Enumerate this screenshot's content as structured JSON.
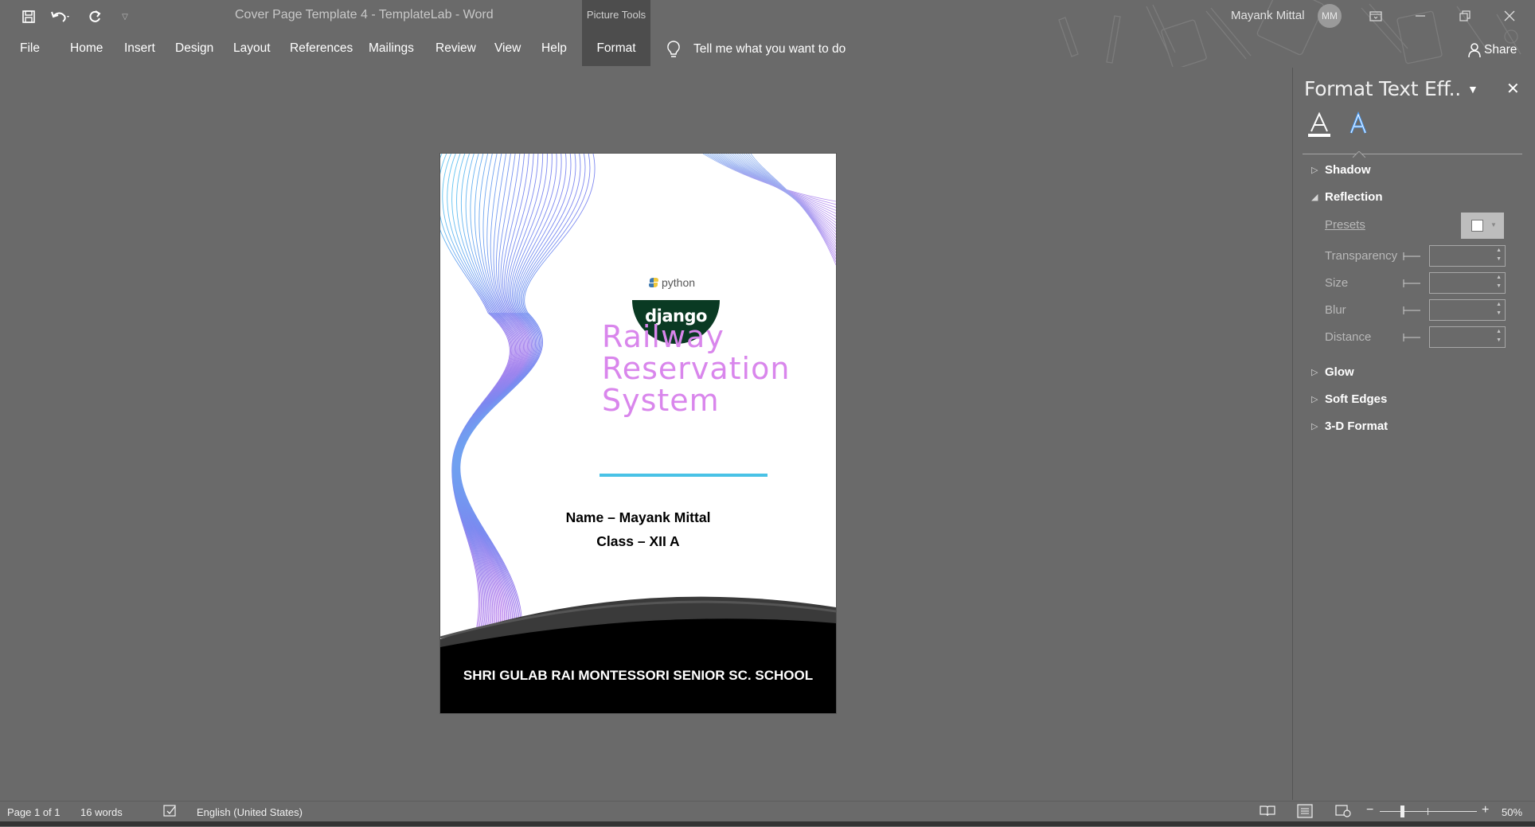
{
  "window": {
    "title": "Cover Page Template 4 - TemplateLab  -  Word",
    "context_tab_group": "Picture Tools",
    "user_name": "Mayank Mittal",
    "user_initials": "MM"
  },
  "ribbon": {
    "tabs": [
      "File",
      "Home",
      "Insert",
      "Design",
      "Layout",
      "References",
      "Mailings",
      "Review",
      "View",
      "Help",
      "Format"
    ],
    "tell_me": "Tell me what you want to do",
    "share": "Share"
  },
  "document": {
    "python_label": "python",
    "django_label": "django",
    "title_lines": [
      "Railway",
      "Reservation",
      "System"
    ],
    "name_line": "Name – Mayank Mittal",
    "class_line": "Class – XII A",
    "school": "SHRI GULAB RAI MONTESSORI SENIOR SC. SCHOOL"
  },
  "format_pane": {
    "title": "Format Text Eff..",
    "sections": {
      "shadow": "Shadow",
      "reflection": "Reflection",
      "glow": "Glow",
      "soft_edges": "Soft Edges",
      "three_d": "3-D Format"
    },
    "reflection_fields": {
      "presets": "Presets",
      "transparency": "Transparency",
      "size": "Size",
      "blur": "Blur",
      "distance": "Distance"
    }
  },
  "status": {
    "page": "Page 1 of 1",
    "words": "16 words",
    "language": "English (United States)",
    "zoom": "50%"
  },
  "colors": {
    "app_bg": "#6a6a6a",
    "active_tab": "#4d4d4d",
    "title_text": "#d986ec",
    "underline": "#49c2e6",
    "django_green": "#0a3a23"
  },
  "icons": [
    "save-icon",
    "undo-icon",
    "redo-icon",
    "customize-qat-icon",
    "lightbulb-icon",
    "share-person-icon",
    "ribbon-display-icon",
    "minimize-icon",
    "restore-icon",
    "close-icon",
    "text-fill-icon",
    "text-effects-icon",
    "read-mode-icon",
    "print-layout-icon",
    "web-layout-icon",
    "zoom-out-icon",
    "zoom-in-icon",
    "proofing-icon"
  ]
}
